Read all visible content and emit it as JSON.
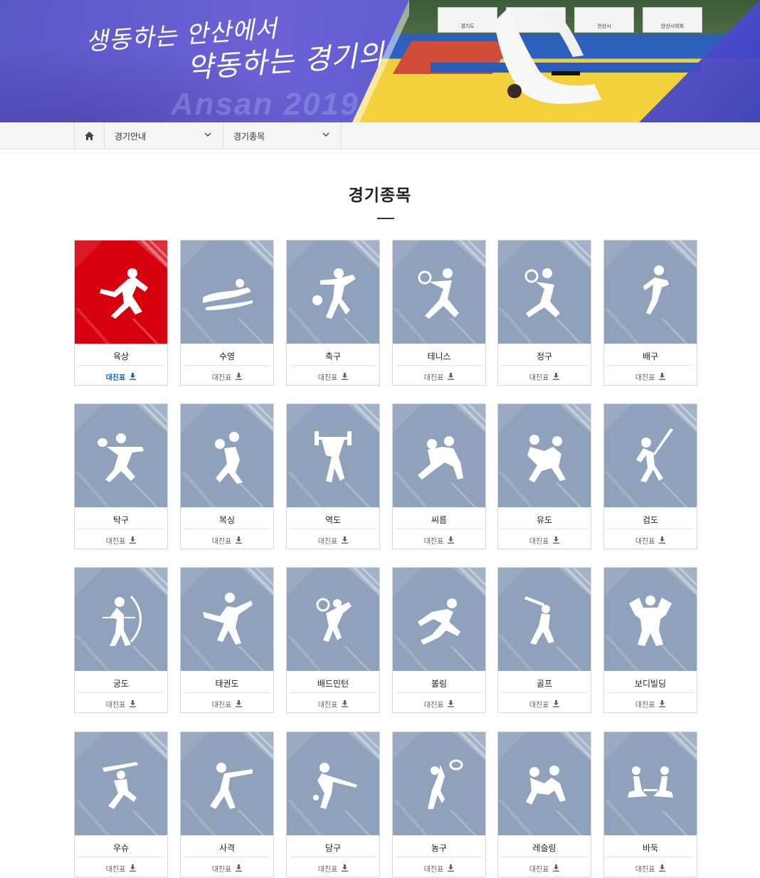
{
  "banner": {
    "slogan_line1": "생동하는 안산에서",
    "slogan_line2": "약동하는 경기의 꿈",
    "watermark": "Ansan 2019",
    "signs": [
      "경기도",
      "",
      "안산시",
      "안산시의회"
    ]
  },
  "breadcrumb": {
    "home_icon": "home-icon",
    "items": [
      {
        "label": "경기안내"
      },
      {
        "label": "경기종목"
      }
    ]
  },
  "page": {
    "title": "경기종목"
  },
  "download_label": "대진표",
  "colors": {
    "active": "#d7000f",
    "tile": "#8fa1bb",
    "link": "#1a5fb4"
  },
  "sports": [
    {
      "name": "육상",
      "icon": "athletics-icon",
      "active": true
    },
    {
      "name": "수영",
      "icon": "swimming-icon"
    },
    {
      "name": "축구",
      "icon": "soccer-icon"
    },
    {
      "name": "테니스",
      "icon": "tennis-icon"
    },
    {
      "name": "정구",
      "icon": "soft-tennis-icon"
    },
    {
      "name": "배구",
      "icon": "volleyball-icon"
    },
    {
      "name": "탁구",
      "icon": "table-tennis-icon"
    },
    {
      "name": "복싱",
      "icon": "boxing-icon"
    },
    {
      "name": "역도",
      "icon": "weightlifting-icon"
    },
    {
      "name": "씨름",
      "icon": "ssireum-icon"
    },
    {
      "name": "유도",
      "icon": "judo-icon"
    },
    {
      "name": "검도",
      "icon": "kendo-icon"
    },
    {
      "name": "궁도",
      "icon": "archery-icon"
    },
    {
      "name": "태권도",
      "icon": "taekwondo-icon"
    },
    {
      "name": "배드민턴",
      "icon": "badminton-icon"
    },
    {
      "name": "볼링",
      "icon": "bowling-icon"
    },
    {
      "name": "골프",
      "icon": "golf-icon"
    },
    {
      "name": "보디빌딩",
      "icon": "bodybuilding-icon"
    },
    {
      "name": "우슈",
      "icon": "wushu-icon"
    },
    {
      "name": "사격",
      "icon": "shooting-icon"
    },
    {
      "name": "당구",
      "icon": "billiards-icon"
    },
    {
      "name": "농구",
      "icon": "basketball-icon"
    },
    {
      "name": "레슬링",
      "icon": "wrestling-icon"
    },
    {
      "name": "바둑",
      "icon": "baduk-icon"
    }
  ]
}
